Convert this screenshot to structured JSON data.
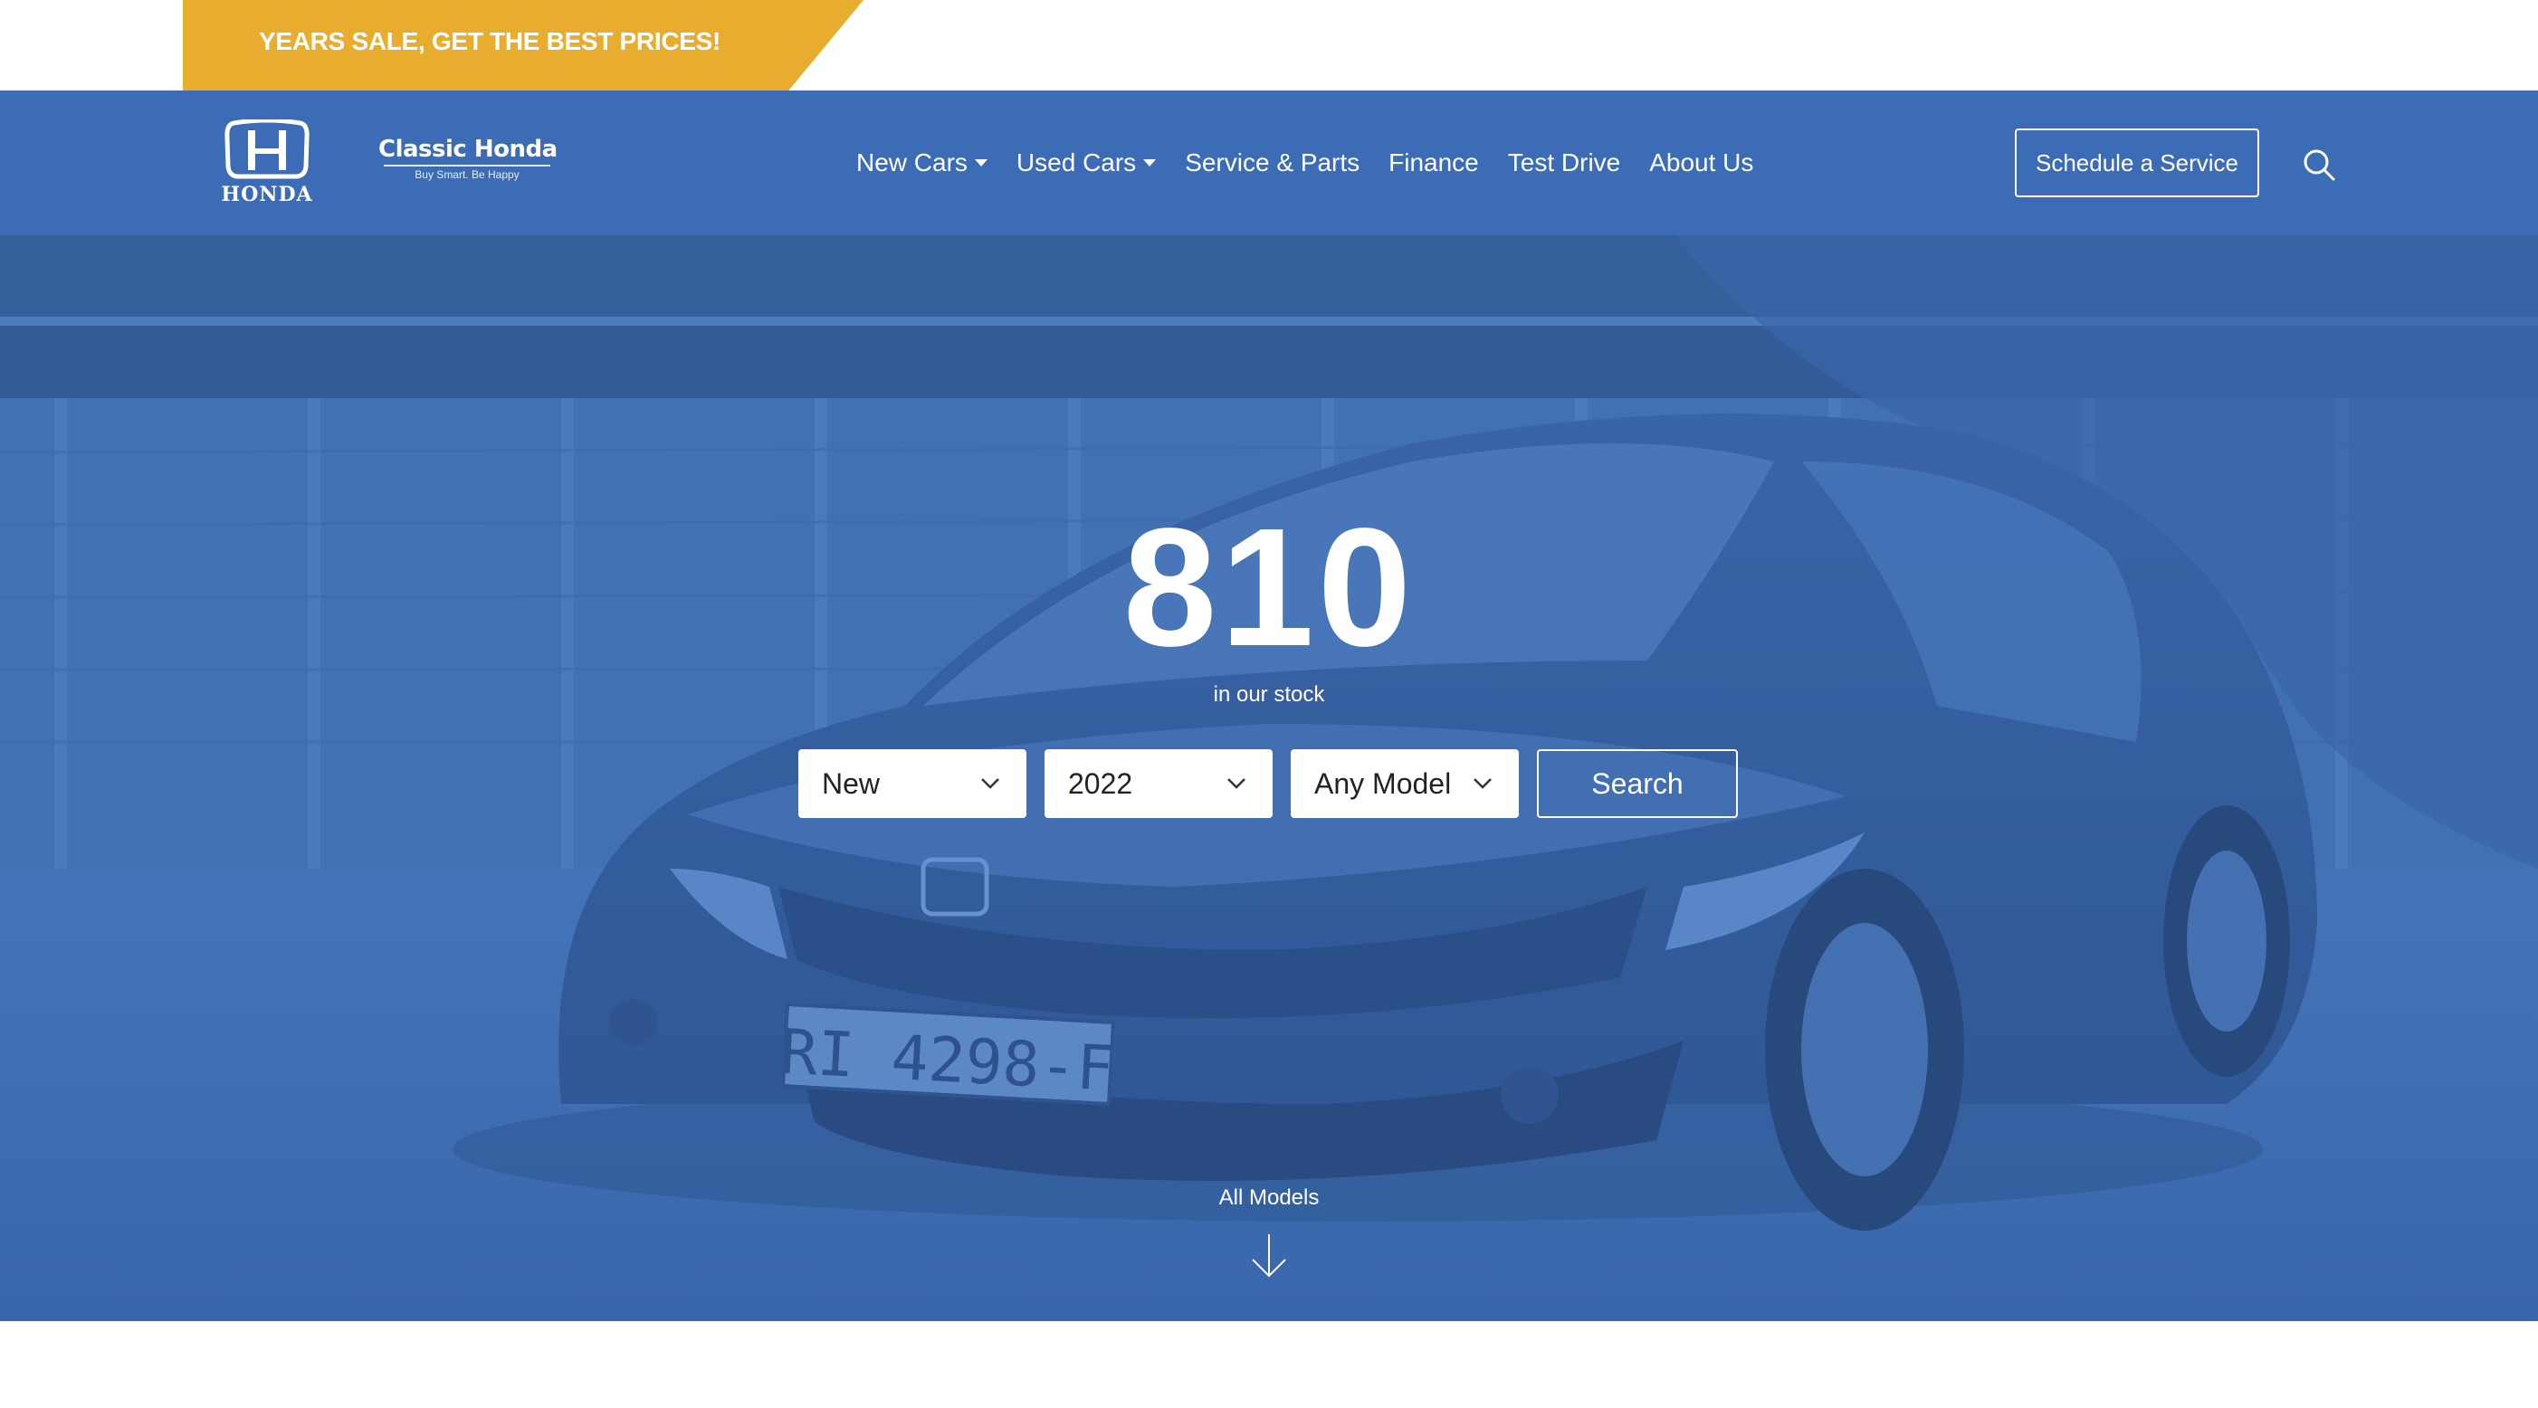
{
  "promo": {
    "text": "YEARS SALE, GET THE BEST PRICES!",
    "color": "#e8ac2f"
  },
  "brand": {
    "logo_text": "HONDA",
    "name": "Classic Honda",
    "tagline": "Buy Smart. Be Happy",
    "nav_color": "#3b6cb5"
  },
  "nav": {
    "items": [
      {
        "label": "New Cars",
        "dropdown": true
      },
      {
        "label": "Used Cars",
        "dropdown": true
      },
      {
        "label": "Service & Parts",
        "dropdown": false
      },
      {
        "label": "Finance",
        "dropdown": false
      },
      {
        "label": "Test Drive",
        "dropdown": false
      },
      {
        "label": "About Us",
        "dropdown": false
      }
    ],
    "schedule_button": "Schedule a Service",
    "search_icon": "search-icon"
  },
  "hero": {
    "count": "810",
    "subtitle": "in our stock",
    "plate_text": "RI 4298-F",
    "filters": {
      "condition": "New",
      "year": "2022",
      "model": "Any Model"
    },
    "search_button": "Search",
    "all_models": "All Models",
    "arrow_icon": "arrow-down-icon"
  }
}
